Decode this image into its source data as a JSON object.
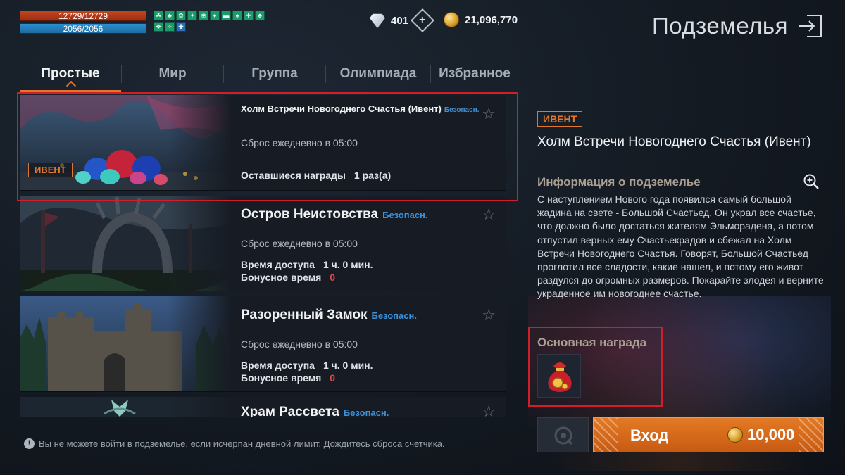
{
  "hud": {
    "hp": "12729/12729",
    "mp": "2056/2056",
    "buffs": [
      "☘",
      "♣",
      "✿",
      "✦",
      "❀",
      "♦",
      "▬",
      "♠",
      "✚",
      "♣",
      "❖",
      "✧",
      "✚"
    ],
    "diamonds": "401",
    "gold": "21,096,770"
  },
  "header": {
    "title": "Подземелья"
  },
  "tabs": [
    {
      "label": "Простые"
    },
    {
      "label": "Мир"
    },
    {
      "label": "Группа"
    },
    {
      "label": "Олимпиада"
    },
    {
      "label": "Избранное"
    }
  ],
  "dungeons": [
    {
      "badge": "ИВЕНТ",
      "name": "Холм Встречи Новогоднего Счастья (Ивент)",
      "safety": "Безопасн.",
      "reset": "Сброс ежедневно в 05:00",
      "rewards_label": "Оставшиеся награды",
      "rewards_value": "1 раз(а)"
    },
    {
      "name": "Остров Неистовства",
      "safety": "Безопасн.",
      "reset": "Сброс ежедневно в 05:00",
      "time_label": "Время доступа",
      "time_value": "1 ч. 0 мин.",
      "bonus_label": "Бонусное время",
      "bonus_value": "0"
    },
    {
      "name": "Разоренный Замок",
      "safety": "Безопасн.",
      "reset": "Сброс ежедневно в 05:00",
      "time_label": "Время доступа",
      "time_value": "1 ч. 0 мин.",
      "bonus_label": "Бонусное время",
      "bonus_value": "0"
    },
    {
      "name": "Храм Рассвета",
      "safety": "Безопасн."
    }
  ],
  "notice": "Вы не можете войти в подземелье, если исчерпан дневной лимит. Дождитесь сброса счетчика.",
  "detail": {
    "badge": "ИВЕНТ",
    "title": "Холм Встречи Новогоднего Счастья (Ивент)",
    "info_heading": "Информация о подземелье",
    "description": "С наступлением Нового года появился самый большой жадина на свете - Большой Счастьед. Он украл все счастье, что должно было достаться жителям Эльморадена, а потом отпустил верных ему Счастьекрадов и сбежал на Холм Встречи Новогоднего Счастья. Говорят, Большой Счастьед проглотил все сладости, какие нашел, и потому его живот раздулся до огромных размеров. Покарайте злодея и верните украденное им новогоднее счастье.",
    "reward_heading": "Основная награда"
  },
  "enter": {
    "label": "Вход",
    "cost": "10,000"
  },
  "colors": {
    "accent": "#e0772b",
    "safe": "#3c91d8",
    "selection": "#d21e28"
  }
}
